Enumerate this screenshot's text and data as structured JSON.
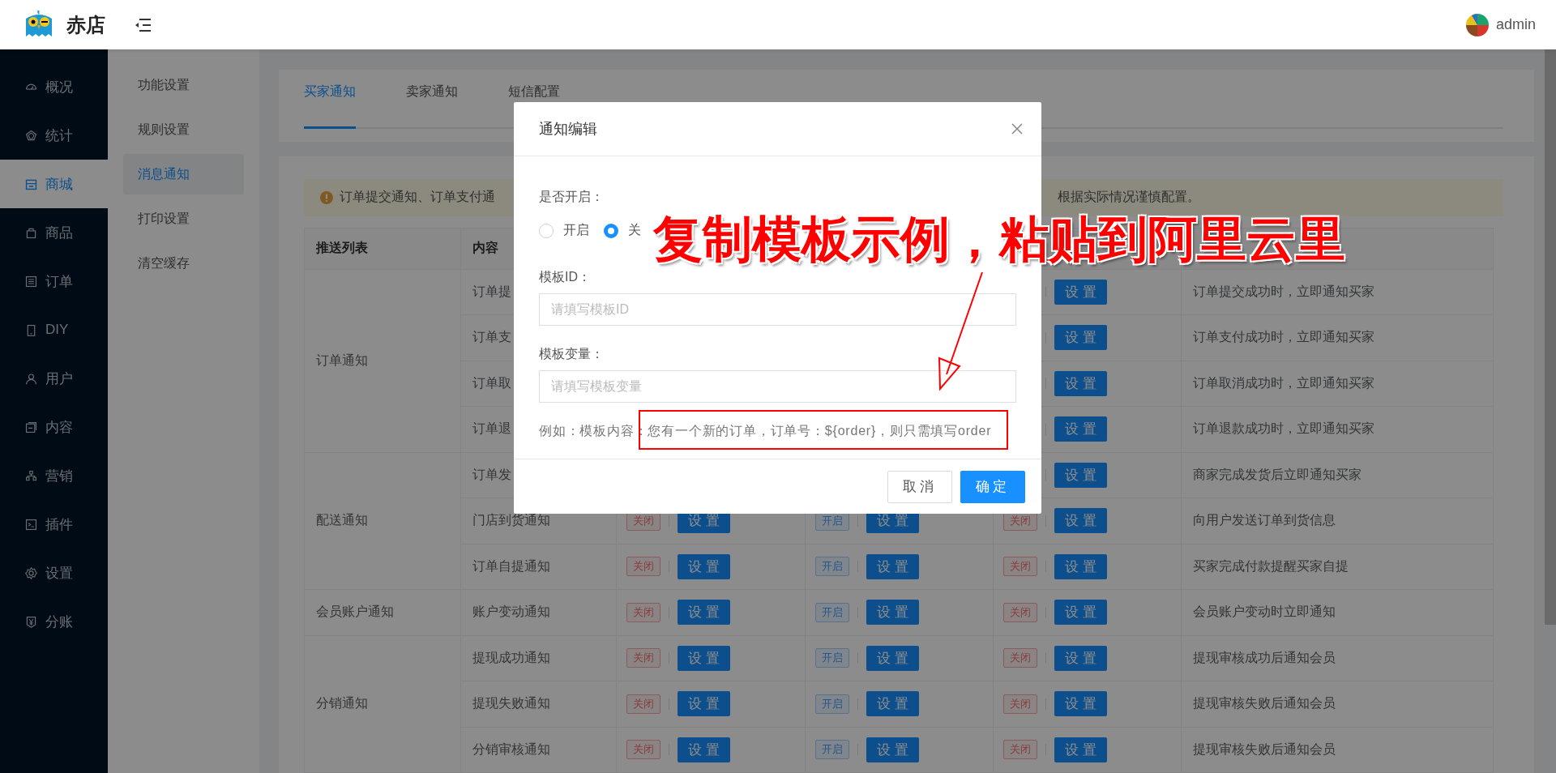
{
  "header": {
    "brand": "赤店",
    "user": "admin"
  },
  "sidebar": {
    "items": [
      {
        "label": "概况",
        "selected": false
      },
      {
        "label": "统计",
        "selected": false
      },
      {
        "label": "商城",
        "selected": true
      },
      {
        "label": "商品",
        "selected": false
      },
      {
        "label": "订单",
        "selected": false
      },
      {
        "label": "DIY",
        "selected": false
      },
      {
        "label": "用户",
        "selected": false
      },
      {
        "label": "内容",
        "selected": false
      },
      {
        "label": "营销",
        "selected": false
      },
      {
        "label": "插件",
        "selected": false
      },
      {
        "label": "设置",
        "selected": false
      },
      {
        "label": "分账",
        "selected": false
      }
    ]
  },
  "submenu": {
    "items": [
      {
        "label": "功能设置",
        "selected": false
      },
      {
        "label": "规则设置",
        "selected": false
      },
      {
        "label": "消息通知",
        "selected": true
      },
      {
        "label": "打印设置",
        "selected": false
      },
      {
        "label": "清空缓存",
        "selected": false
      }
    ]
  },
  "tabs": [
    {
      "label": "买家通知",
      "selected": true
    },
    {
      "label": "卖家通知",
      "selected": false
    },
    {
      "label": "短信配置",
      "selected": false
    }
  ],
  "alert": {
    "text_start": "订单提交通知、订单支付通",
    "text_end": "根据实际情况谨慎配置。"
  },
  "table": {
    "columns": [
      "推送列表",
      "内容"
    ],
    "groups": [
      {
        "name": "订单通知",
        "rows": [
          {
            "content": "订单提",
            "channel_3": {
              "button": "设置"
            },
            "description": "订单提交成功时，立即通知买家"
          },
          {
            "content": "订单支",
            "channel_3": {
              "button": "设置"
            },
            "description": "订单支付成功时，立即通知买家"
          },
          {
            "content": "订单取",
            "channel_3": {
              "button": "设置"
            },
            "description": "订单取消成功时，立即通知买家"
          },
          {
            "content": "订单退",
            "channel_3": {
              "button": "设置"
            },
            "description": "订单退款成功时，立即通知买家"
          }
        ]
      },
      {
        "name": "配送通知",
        "rows": [
          {
            "content": "订单发",
            "channel_3": {
              "button": "设置"
            },
            "description": "商家完成发货后立即通知买家"
          },
          {
            "content": "门店到货通知",
            "channel_1": {
              "tag": "关闭",
              "on": false,
              "button": "设置"
            },
            "channel_2": {
              "tag": "开启",
              "on": true,
              "button": "设置"
            },
            "channel_3": {
              "tag": "关闭",
              "on": false,
              "button": "设置"
            },
            "description": "向用户发送订单到货信息"
          },
          {
            "content": "订单自提通知",
            "channel_1": {
              "tag": "关闭",
              "on": false,
              "button": "设置"
            },
            "channel_2": {
              "tag": "开启",
              "on": true,
              "button": "设置"
            },
            "channel_3": {
              "tag": "关闭",
              "on": false,
              "button": "设置"
            },
            "description": "买家完成付款提醒买家自提"
          }
        ]
      },
      {
        "name": "会员账户通知",
        "rows": [
          {
            "content": "账户变动通知",
            "channel_1": {
              "tag": "关闭",
              "on": false,
              "button": "设置"
            },
            "channel_2": {
              "tag": "开启",
              "on": true,
              "button": "设置"
            },
            "channel_3": {
              "tag": "关闭",
              "on": false,
              "button": "设置"
            },
            "description": "会员账户变动时立即通知"
          }
        ]
      },
      {
        "name": "分销通知",
        "rows": [
          {
            "content": "提现成功通知",
            "channel_1": {
              "tag": "关闭",
              "on": false,
              "button": "设置"
            },
            "channel_2": {
              "tag": "开启",
              "on": true,
              "button": "设置"
            },
            "channel_3": {
              "tag": "关闭",
              "on": false,
              "button": "设置"
            },
            "description": "提现审核成功后通知会员"
          },
          {
            "content": "提现失败通知",
            "channel_1": {
              "tag": "关闭",
              "on": false,
              "button": "设置"
            },
            "channel_2": {
              "tag": "开启",
              "on": true,
              "button": "设置"
            },
            "channel_3": {
              "tag": "关闭",
              "on": false,
              "button": "设置"
            },
            "description": "提现审核失败后通知会员"
          },
          {
            "content": "分销审核通知",
            "channel_1": {
              "tag": "关闭",
              "on": false,
              "button": "设置"
            },
            "channel_2": {
              "tag": "开启",
              "on": true,
              "button": "设置"
            },
            "channel_3": {
              "tag": "关闭",
              "on": false,
              "button": "设置"
            },
            "description": "提现审核失败后通知会员"
          }
        ]
      }
    ]
  },
  "modal": {
    "title": "通知编辑",
    "fields": [
      {
        "kind": "radio",
        "label": "是否开启：",
        "options": [
          {
            "label": "开启",
            "selected": false
          },
          {
            "label": "关",
            "selected": true
          }
        ]
      },
      {
        "kind": "input",
        "label": "模板ID：",
        "placeholder": "请填写模板ID"
      },
      {
        "kind": "input",
        "label": "模板变量：",
        "placeholder": "请填写模板变量"
      }
    ],
    "hint": "例如：模板内容：您有一个新的订单，订单号：${order}，则只需填写order",
    "buttons": [
      {
        "label": "取消",
        "kind": "default"
      },
      {
        "label": "确定",
        "kind": "primary"
      }
    ]
  },
  "annotation": {
    "text": "复制模板示例，粘贴到阿里云里"
  }
}
